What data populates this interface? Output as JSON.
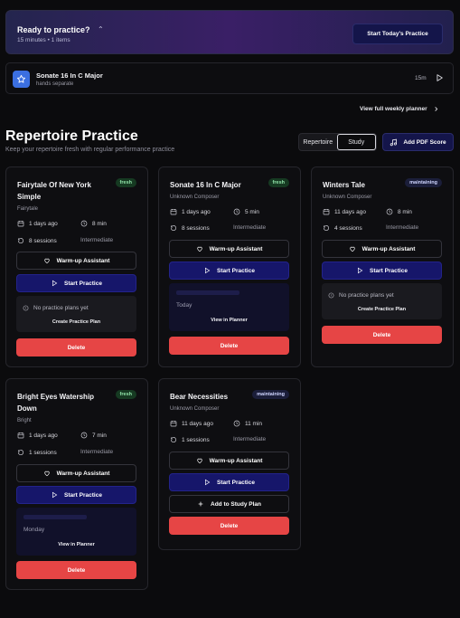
{
  "banner": {
    "title": "Ready to practice?",
    "subtitle": "15 minutes • 1 items",
    "start_button": "Start Today's Practice"
  },
  "session": {
    "icon": "star-icon",
    "title": "Sonate 16 In C Major",
    "subtitle": "hands separate",
    "duration": "15m"
  },
  "planner_link": "View full weekly planner",
  "section": {
    "title": "Repertoire Practice",
    "subtitle": "Keep your repertoire fresh with regular performance practice",
    "tabs": [
      "Repertoire",
      "Study"
    ],
    "active_tab": "Study",
    "add_pdf": "Add PDF Score"
  },
  "labels": {
    "warmup": "Warm-up Assistant",
    "start_practice": "Start Practice",
    "delete": "Delete",
    "no_plans": "No practice plans yet",
    "create_plan": "Create Practice Plan",
    "view_in_planner": "View in Planner",
    "add_to_study": "Add to Study Plan"
  },
  "cards": [
    {
      "title": "Fairytale Of New York Simple",
      "subtitle": "Fairytale",
      "badge": "fresh",
      "last": "1 days ago",
      "duration": "8 min",
      "sessions": "8 sessions",
      "level": "Intermediate"
    },
    {
      "title": "Sonate 16 In C Major",
      "subtitle": "Unknown Composer",
      "badge": "fresh",
      "last": "1 days ago",
      "duration": "5 min",
      "sessions": "8 sessions",
      "level": "Intermediate",
      "plan_day": "Today"
    },
    {
      "title": "Winters Tale",
      "subtitle": "Unknown Composer",
      "badge": "maintaining",
      "last": "11 days ago",
      "duration": "8 min",
      "sessions": "4 sessions",
      "level": "Intermediate"
    },
    {
      "title": "Bright Eyes Watership Down",
      "subtitle": "Bright",
      "badge": "fresh",
      "last": "1 days ago",
      "duration": "7 min",
      "sessions": "1 sessions",
      "level": "Intermediate",
      "plan_day": "Monday"
    },
    {
      "title": "Bear Necessities",
      "subtitle": "Unknown Composer",
      "badge": "maintaining",
      "last": "11 days ago",
      "duration": "11 min",
      "sessions": "1 sessions",
      "level": "Intermediate"
    }
  ]
}
